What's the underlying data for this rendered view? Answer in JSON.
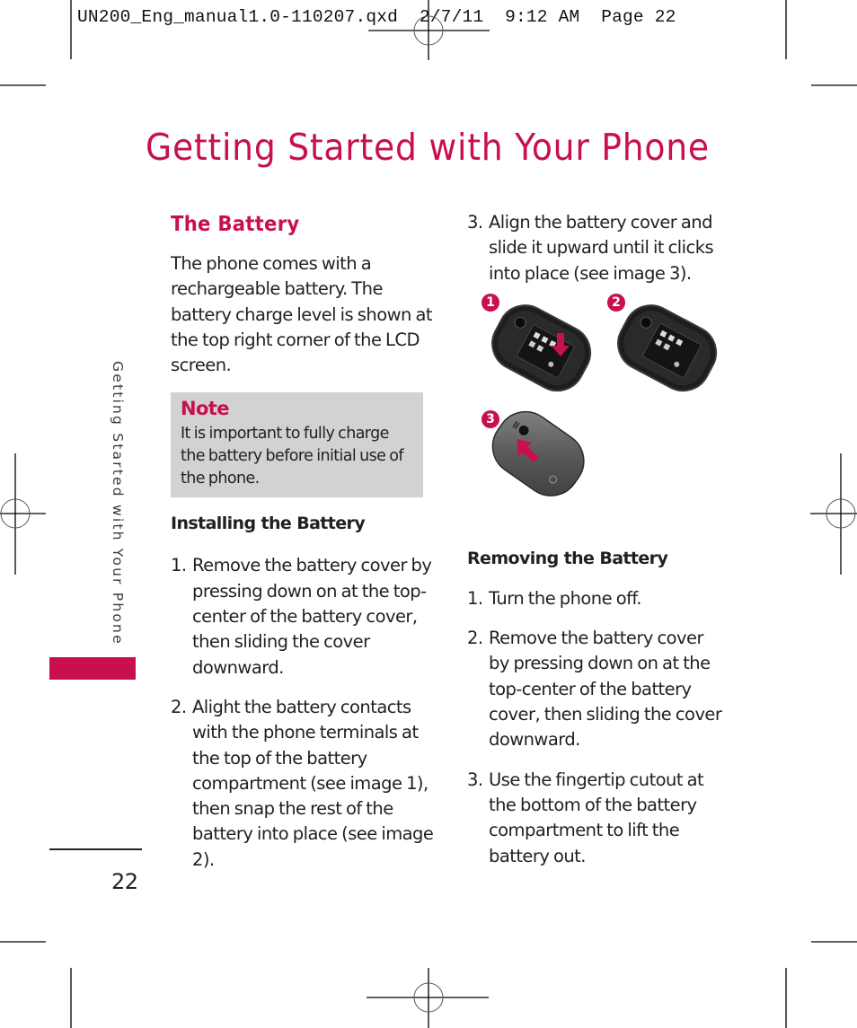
{
  "slug": {
    "text": "UN200_Eng_manual1.0-110207.qxd  2/7/11  9:12 AM  Page 22"
  },
  "page": {
    "title": "Getting Started with Your Phone",
    "side_label": "Getting Started with Your Phone",
    "page_number": "22",
    "accent_color": "#c8104f"
  },
  "battery": {
    "heading": "The Battery",
    "intro": "The phone comes with a rechargeable battery. The battery charge level is shown at the top right corner of the LCD screen.",
    "note": {
      "title": "Note",
      "text": "It is important to fully charge the battery before initial use of the phone."
    },
    "installing": {
      "heading": "Installing the Battery",
      "steps": [
        {
          "num": "1.",
          "text": "Remove the battery cover by pressing down on at the top-center of the battery cover, then sliding the cover downward."
        },
        {
          "num": "2.",
          "text": "Alight the battery contacts with the phone terminals at the top of the battery compartment (see image 1), then snap the rest of the battery into place (see image 2)."
        },
        {
          "num": "3.",
          "text": "Align the battery cover and slide it upward until it clicks into place (see image 3)."
        }
      ]
    },
    "images": [
      {
        "badge": "1",
        "icon": "phone-battery-insert-image"
      },
      {
        "badge": "2",
        "icon": "phone-battery-seated-image"
      },
      {
        "badge": "3",
        "icon": "phone-cover-attached-image"
      }
    ],
    "removing": {
      "heading": "Removing the Battery",
      "steps": [
        {
          "num": "1.",
          "text": "Turn the phone off."
        },
        {
          "num": "2.",
          "text": "Remove the battery cover by pressing down on at the top-center of the battery cover, then sliding the cover downward."
        },
        {
          "num": "3.",
          "text": "Use the fingertip cutout at the bottom of the battery compartment to lift the battery out."
        }
      ]
    }
  }
}
